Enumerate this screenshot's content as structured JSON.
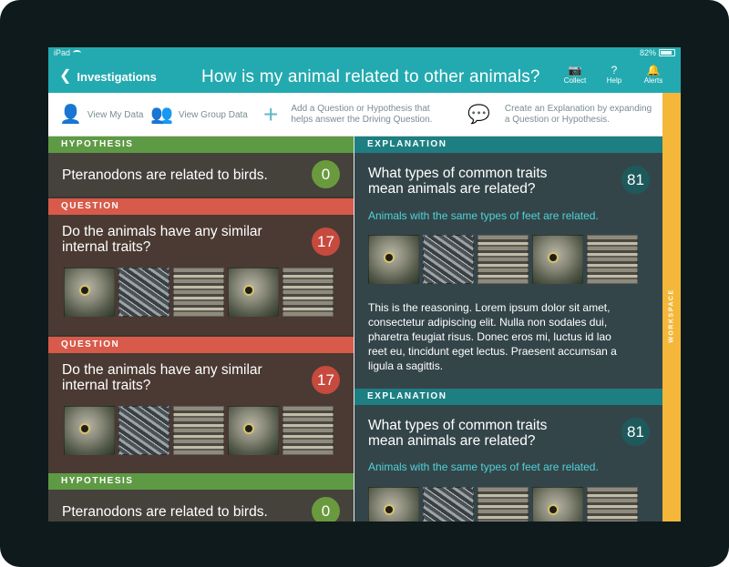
{
  "status": {
    "device": "iPad",
    "battery": "82%"
  },
  "nav": {
    "back_label": "Investigations",
    "title": "How is my animal related to other animals?",
    "buttons": [
      {
        "label": "Collect",
        "icon": "camera-icon"
      },
      {
        "label": "Help",
        "icon": "question-icon"
      },
      {
        "label": "Alerts",
        "icon": "bell-icon"
      }
    ]
  },
  "toolbar": {
    "view_my_data": "View My Data",
    "view_group_data": "View Group Data",
    "add_question_line1": "Add a Question or Hypothesis that",
    "add_question_line2": "helps answer the Driving Question.",
    "create_explanation_line1": "Create an Explanation by expanding",
    "create_explanation_line2": "a Question or Hypothesis."
  },
  "workspace_label": "WORKSPACE",
  "left_cards": [
    {
      "type": "HYPOTHESIS",
      "text": "Pteranodons are related to birds.",
      "count": "0"
    },
    {
      "type": "QUESTION",
      "line1": "Do the animals have any similar",
      "line2": "internal traits?",
      "count": "17"
    },
    {
      "type": "QUESTION",
      "line1": "Do the animals have any similar",
      "line2": "internal traits?",
      "count": "17"
    },
    {
      "type": "HYPOTHESIS",
      "text": "Pteranodons are related to birds.",
      "count": "0"
    }
  ],
  "right_cards": [
    {
      "type": "EXPLANATION",
      "line1": "What types of common traits",
      "line2": "mean animals are related?",
      "count": "81",
      "sub": "Animals with the same types of feet are related.",
      "reasoning": [
        "This is the reasoning. Lorem ipsum dolor sit amet,",
        "consectetur adipiscing elit. Nulla non sodales dui,",
        "pharetra feugiat risus. Donec eros mi, luctus id lao",
        "reet eu, tincidunt eget lectus. Praesent accumsan a",
        "ligula a sagittis."
      ]
    },
    {
      "type": "EXPLANATION",
      "line1": "What types of common traits",
      "line2": "mean animals are related?",
      "count": "81",
      "sub": "Animals with the same types of feet are related."
    }
  ],
  "colors": {
    "teal": "#23aab0",
    "hypothesis": "#5e9a44",
    "question": "#d75a4a",
    "explanation": "#1d7f82",
    "workspace": "#f4b73a"
  }
}
